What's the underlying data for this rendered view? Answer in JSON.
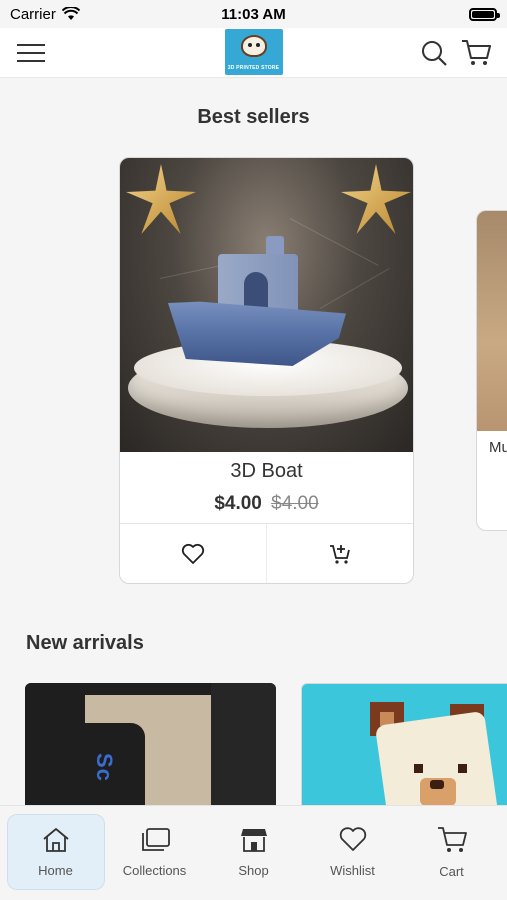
{
  "status_bar": {
    "carrier": "Carrier",
    "time": "11:03 AM"
  },
  "header": {
    "logo_text": "3D PRINTED STORE"
  },
  "best_sellers": {
    "title": "Best sellers",
    "featured": {
      "name": "3D Boat",
      "price": "$4.00",
      "old_price": "$4.00"
    },
    "peek_label": "Mu"
  },
  "new_arrivals": {
    "title": "New arrivals",
    "item1_overlay_text": "Sc"
  },
  "tab_bar": {
    "tabs": [
      {
        "label": "Home",
        "icon": "home-icon",
        "active": true
      },
      {
        "label": "Collections",
        "icon": "collections-icon",
        "active": false
      },
      {
        "label": "Shop",
        "icon": "shop-icon",
        "active": false
      },
      {
        "label": "Wishlist",
        "icon": "heart-icon",
        "active": false
      },
      {
        "label": "Cart",
        "icon": "cart-icon",
        "active": false
      }
    ]
  },
  "colors": {
    "accent_active_tab": "#e2eff8",
    "logo_bg": "#35a8d6"
  }
}
